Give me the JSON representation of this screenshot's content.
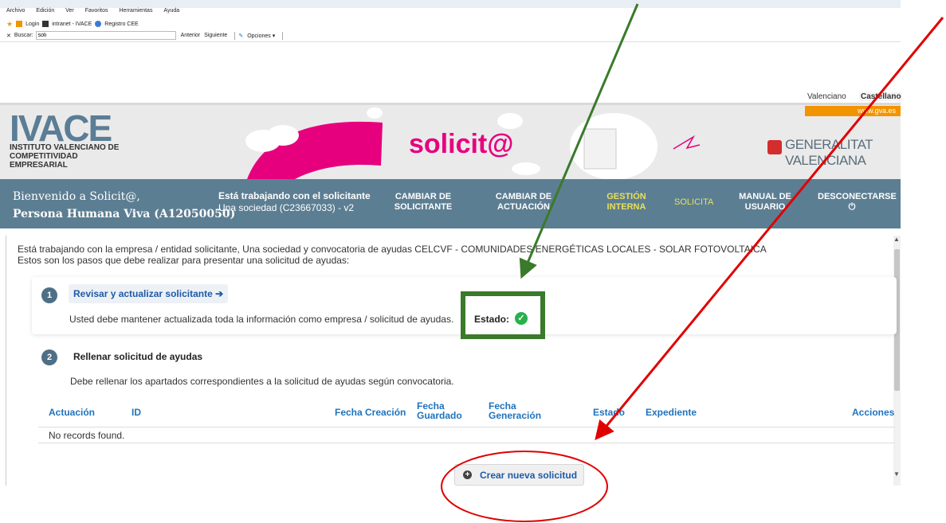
{
  "browser": {
    "menu": [
      "Archivo",
      "Edición",
      "Ver",
      "Favoritos",
      "Herramientas",
      "Ayuda"
    ],
    "favorites": [
      "Login",
      "intranet - IVACE",
      "Registro CEE"
    ],
    "find": {
      "label": "Buscar:",
      "value": "soli",
      "prev": "Anterior",
      "next": "Siguiente",
      "options": "Opciones ▾"
    }
  },
  "language": {
    "valenciano": "Valenciano",
    "castellano": "Castellano"
  },
  "header": {
    "logo": "IVACE",
    "logo_sub": "INSTITUTO VALENCIANO DE COMPETITIVIDAD EMPRESARIAL",
    "app_title": "solicit@",
    "gv_logo": "GENERALITAT VALENCIANA",
    "gvaes": "www.gva.es"
  },
  "nav": {
    "welcome_line1": "Bienvenido a Solicit@,",
    "welcome_line2": "Persona Humana Viva (A12050050)",
    "working_line1": "Está trabajando con el solicitante",
    "working_line2": "Una sociedad (C23667033) - v2",
    "cambiar_solicitante_1": "CAMBIAR DE",
    "cambiar_solicitante_2": "SOLICITANTE",
    "cambiar_actuacion_1": "CAMBIAR DE",
    "cambiar_actuacion_2": "ACTUACIÓN",
    "gestion_1": "GESTIÓN",
    "gestion_2": "INTERNA",
    "solicita": "SOLICITA",
    "manual_1": "MANUAL DE",
    "manual_2": "USUARIO",
    "desconectarse": "DESCONECTARSE",
    "power_icon": "⏻"
  },
  "content": {
    "intro_line1": "Está trabajando con la empresa / entidad solicitante, Una sociedad y convocatoria de ayudas CELCVF - COMUNIDADES ENERGÉTICAS LOCALES - SOLAR FOTOVOLTAICA",
    "intro_line2": "Estos son los pasos que debe realizar para presentar una solicitud de ayudas:",
    "step1": {
      "num": "1",
      "link": "Revisar y actualizar solicitante ➔",
      "desc": "Usted debe mantener actualizada toda la información como empresa / solicitud de ayudas.",
      "estado_label": "Estado:",
      "estado_icon": "✓"
    },
    "step2": {
      "num": "2",
      "title": "Rellenar solicitud de ayudas",
      "desc": "Debe rellenar los apartados correspondientes a la solicitud de ayudas según convocatoria."
    },
    "table": {
      "columns": [
        "Actuación",
        "ID",
        "Fecha Creación",
        "Fecha Guardado",
        "Fecha Generación",
        "Estado",
        "Expediente",
        "Acciones"
      ],
      "empty": "No records found."
    },
    "create_button": "Crear nueva solicitud",
    "create_icon": "+"
  },
  "colors": {
    "nav_bg": "#5c7e93",
    "accent_pink": "#e6007e",
    "link_blue": "#1e73be",
    "annotation_green": "#3a7a2a",
    "annotation_red": "#e00000"
  }
}
